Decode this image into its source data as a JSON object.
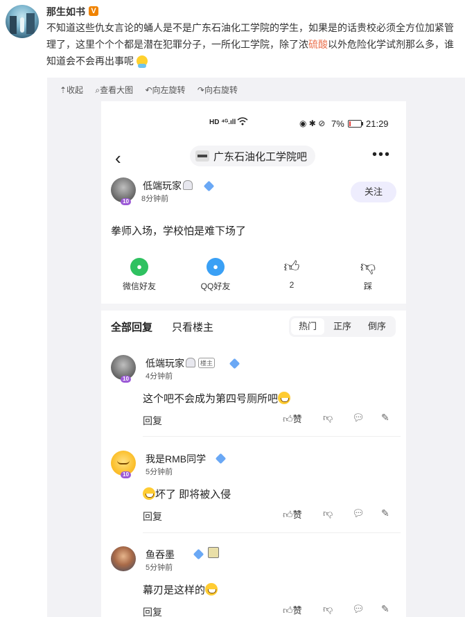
{
  "post": {
    "author": "那生如书",
    "verified_badge": "V",
    "text_part1": "不知道这些仇女言论的蛹人是不是广东石油化工学院的学生，如果是的话贵校必须全方位加紧管理了，这里个个个都是潜在犯罪分子，一所化工学院，除了浓",
    "text_highlight": "硫酸",
    "text_part2": "以外危险化学试剂那么多，谁知道会不会再出事呢",
    "emoji_icon": "worried-face-icon"
  },
  "viewer_tools": {
    "collapse": "⇡收起",
    "view_large": "⌕查看大图",
    "rotate_left": "↶向左旋转",
    "rotate_right": "↷向右旋转"
  },
  "phone": {
    "status": {
      "network": "HD ⁴ᴳ.ıll",
      "wifi_icon": "wifi-icon",
      "icons": "◉ ✱ ⊘",
      "battery_percent": "7%",
      "time": "21:29"
    },
    "nav": {
      "back": "‹",
      "forum_name": "广东石油化工学院吧",
      "more": "•••"
    },
    "op": {
      "username": "低端玩家",
      "time": "8分钟前",
      "level": "10",
      "follow": "关注",
      "title": "拳师入场，学校怕是难下场了"
    },
    "share": {
      "wechat": "微信好友",
      "qq": "QQ好友",
      "likes": "2",
      "dislike": "踩"
    },
    "tabs": {
      "all": "全部回复",
      "op_only": "只看楼主",
      "sort_hot": "热门",
      "sort_asc": "正序",
      "sort_desc": "倒序"
    },
    "replies": [
      {
        "username": "低端玩家",
        "tag": "楼主",
        "time": "4分钟前",
        "level": "10",
        "text": "这个吧不会成为第四号厕所吧",
        "reply": "回复",
        "like": "赞"
      },
      {
        "username": "我是RMB同学",
        "time": "5分钟前",
        "level": "10",
        "text": "坏了 即将被入侵",
        "reply": "回复",
        "like": "赞"
      },
      {
        "username": "鱼吞墨",
        "time": "5分钟前",
        "text": "幕刃是这样的",
        "reply": "回复",
        "like": "赞"
      }
    ]
  }
}
